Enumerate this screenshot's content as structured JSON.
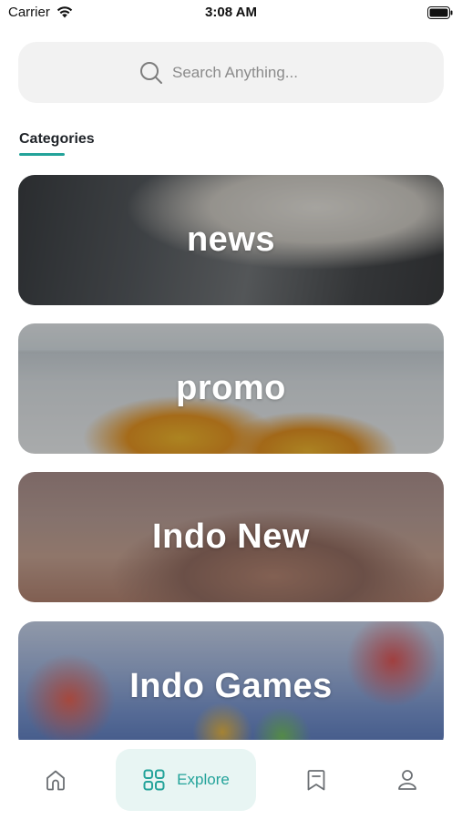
{
  "status_bar": {
    "carrier": "Carrier",
    "time": "3:08 AM"
  },
  "search": {
    "placeholder": "Search Anything..."
  },
  "section": {
    "title": "Categories"
  },
  "categories": [
    {
      "label": "news"
    },
    {
      "label": "promo"
    },
    {
      "label": "Indo New"
    },
    {
      "label": "Indo Games"
    }
  ],
  "bottom_nav": {
    "items": [
      {
        "icon": "home-icon"
      },
      {
        "icon": "grid-icon",
        "label": "Explore",
        "active": true
      },
      {
        "icon": "bookmark-icon"
      },
      {
        "icon": "profile-icon"
      }
    ]
  },
  "colors": {
    "accent": "#23a39a",
    "explore_bg": "#e8f5f3",
    "search_bg": "#f2f2f2"
  }
}
